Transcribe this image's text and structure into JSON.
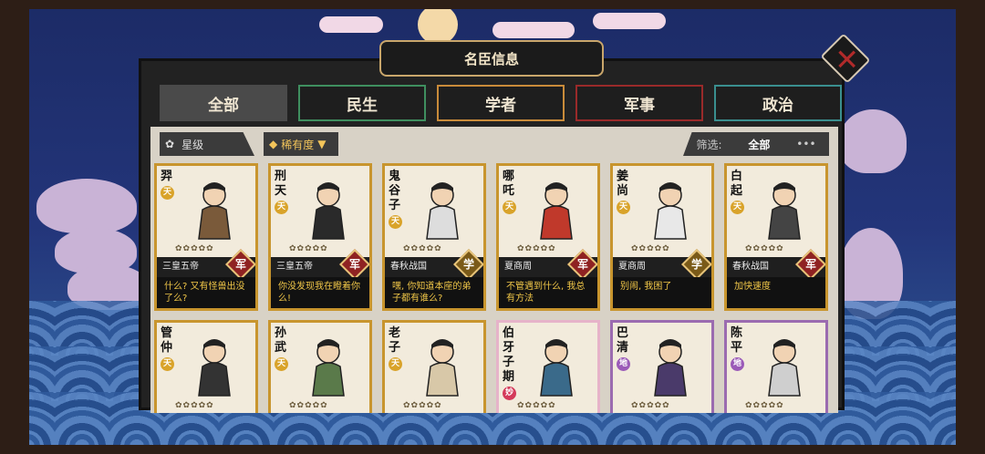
{
  "window": {
    "title": "名臣信息"
  },
  "tabs": [
    "全部",
    "民生",
    "学者",
    "军事",
    "政治"
  ],
  "filters": {
    "star_label": "星级",
    "rarity_label": "稀有度",
    "filter_label": "筛选:",
    "filter_value": "全部",
    "more": "•••"
  },
  "colors": {
    "gold_border": "#c8952e",
    "purple_border": "#9b6bb0",
    "pink_border": "#e6b3c9",
    "quote_text": "#f0c648"
  },
  "cards": [
    {
      "name": "羿",
      "rank": "天",
      "era": "三皇五帝",
      "type": "军",
      "quote": "什么? 又有怪兽出没了么?",
      "stars": "✿✿✿✿✿"
    },
    {
      "name": "刑天",
      "rank": "天",
      "era": "三皇五帝",
      "type": "军",
      "quote": "你没发现我在瞪着你么!",
      "stars": "✿✿✿✿✿"
    },
    {
      "name": "鬼谷子",
      "rank": "天",
      "era": "春秋战国",
      "type": "学",
      "quote": "嘿, 你知道本座的弟子都有谁么?",
      "stars": "✿✿✿✿✿"
    },
    {
      "name": "哪吒",
      "rank": "天",
      "era": "夏商周",
      "type": "军",
      "quote": "不管遇到什么, 我总有方法",
      "stars": "✿✿✿✿✿"
    },
    {
      "name": "姜尚",
      "rank": "天",
      "era": "夏商周",
      "type": "学",
      "quote": "别闹, 我困了",
      "stars": "✿✿✿✿✿"
    },
    {
      "name": "白起",
      "rank": "天",
      "era": "春秋战国",
      "type": "军",
      "quote": "加快速度",
      "stars": "✿✿✿✿✿"
    },
    {
      "name": "管仲",
      "rank": "天",
      "stars": "✿✿✿✿✿"
    },
    {
      "name": "孙武",
      "rank": "天",
      "stars": "✿✿✿✿✿"
    },
    {
      "name": "老子",
      "rank": "天",
      "stars": "✿✿✿✿✿"
    },
    {
      "name": "伯牙子期",
      "rank": "妙",
      "stars": "✿✿✿✿✿"
    },
    {
      "name": "巴清",
      "rank": "地",
      "stars": "✿✿✿✿✿"
    },
    {
      "name": "陈平",
      "rank": "地",
      "stars": "✿✿✿✿✿"
    }
  ]
}
